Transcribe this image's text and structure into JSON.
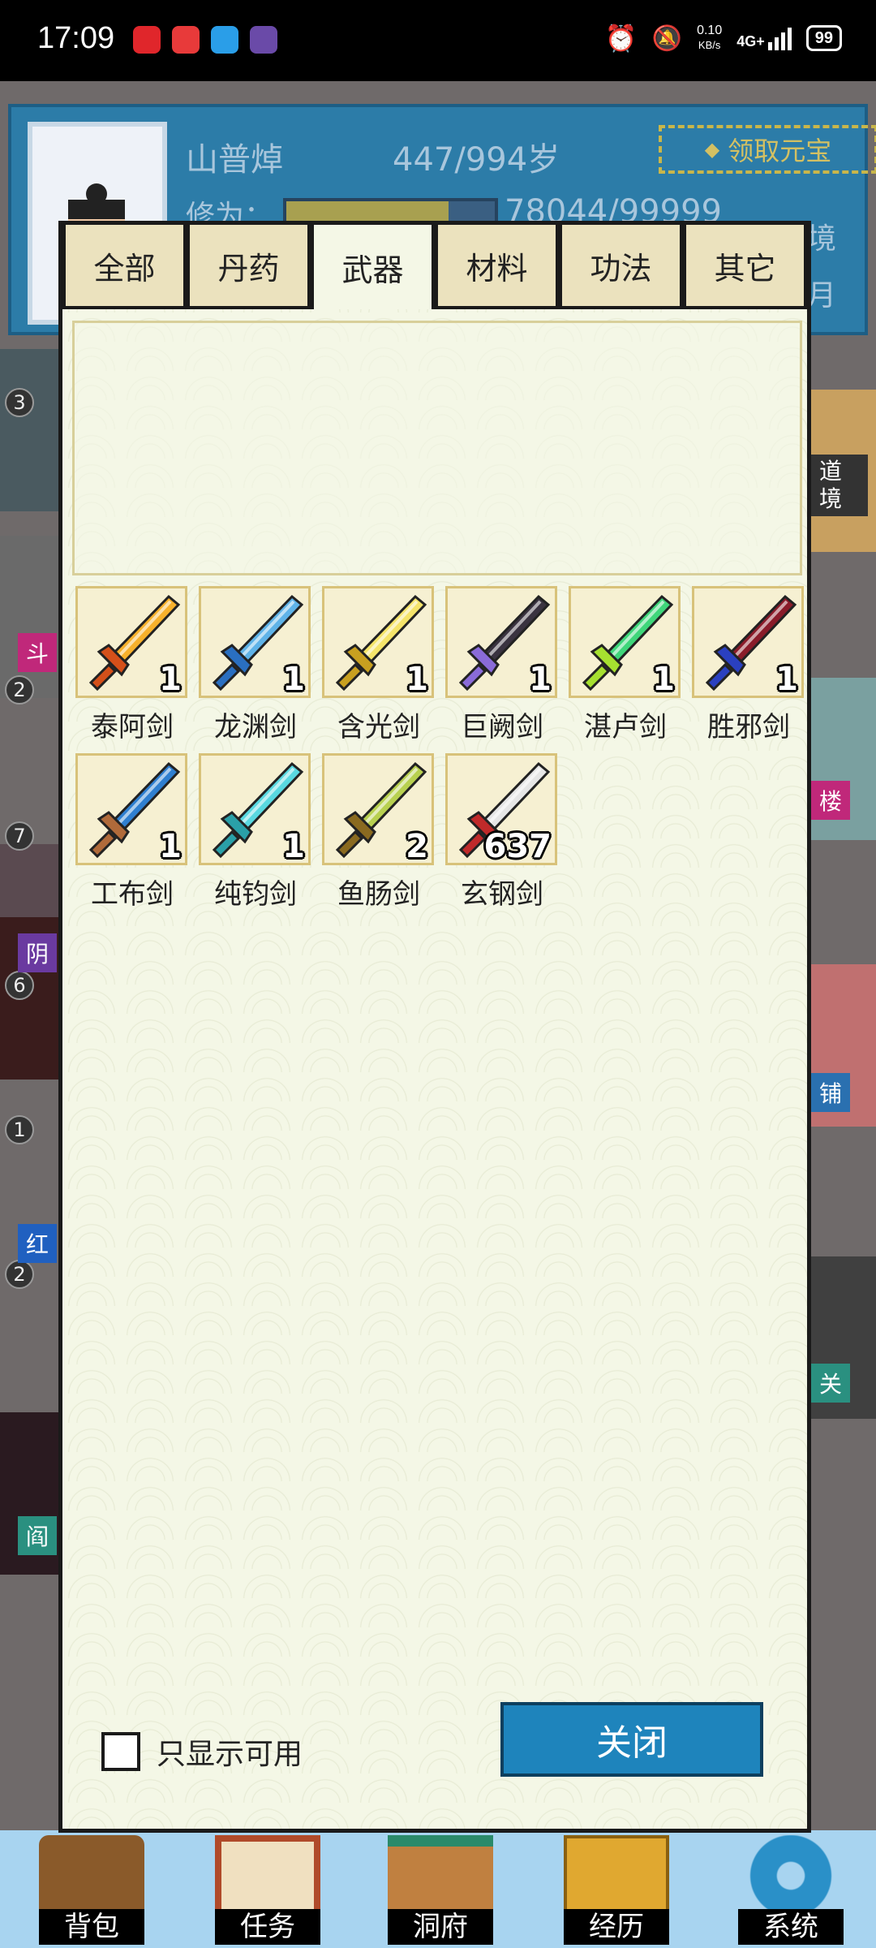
{
  "status_bar": {
    "time": "17:09",
    "speed_value": "0.10",
    "speed_unit": "KB/s",
    "network": "4G+",
    "battery": "99"
  },
  "profile": {
    "name": "山普焯",
    "age": "447/994岁",
    "claim_button": "领取元宝",
    "cultivation_label": "修为：",
    "cultivation_value": "78044/99999",
    "cultivation_progress": 0.78,
    "side_text_1": "境",
    "side_text_2": "月"
  },
  "background_map": {
    "left_tags": [
      "斗",
      "阴",
      "红",
      "阎"
    ],
    "right_tags": [
      "道境",
      "楼",
      "铺",
      "关"
    ],
    "left_numbers": [
      "3",
      "2",
      "7",
      "6",
      "1",
      "2"
    ]
  },
  "tabs": [
    "全部",
    "丹药",
    "武器",
    "材料",
    "功法",
    "其它"
  ],
  "active_tab": "武器",
  "items": [
    {
      "name": "泰阿剑",
      "count": "1",
      "icon": "golden-flame-sword-icon",
      "blade": "#f7b12c",
      "hilt": "#d4501a"
    },
    {
      "name": "龙渊剑",
      "count": "1",
      "icon": "blue-dragon-sword-icon",
      "blade": "#5fb3e8",
      "hilt": "#2a6fc0"
    },
    {
      "name": "含光剑",
      "count": "1",
      "icon": "yellow-light-sword-icon",
      "blade": "#f5e46a",
      "hilt": "#c8a020"
    },
    {
      "name": "巨阙剑",
      "count": "1",
      "icon": "dark-purple-sword-icon",
      "blade": "#3a3340",
      "hilt": "#8a6bd8"
    },
    {
      "name": "湛卢剑",
      "count": "1",
      "icon": "green-jade-sword-icon",
      "blade": "#3fd67a",
      "hilt": "#a6e030"
    },
    {
      "name": "胜邪剑",
      "count": "1",
      "icon": "crimson-evil-sword-icon",
      "blade": "#8a1c2a",
      "hilt": "#2a40c0"
    },
    {
      "name": "工布剑",
      "count": "1",
      "icon": "blue-craft-sword-icon",
      "blade": "#2f7fd0",
      "hilt": "#b06a3a"
    },
    {
      "name": "纯钧剑",
      "count": "1",
      "icon": "cyan-pure-sword-icon",
      "blade": "#59d8e0",
      "hilt": "#2aa0a8"
    },
    {
      "name": "鱼肠剑",
      "count": "2",
      "icon": "fish-gut-dagger-icon",
      "blade": "#b8d050",
      "hilt": "#8a6a20"
    },
    {
      "name": "玄钢剑",
      "count": "637",
      "icon": "steel-sword-icon",
      "blade": "#e6e6e6",
      "hilt": "#c02a2a"
    }
  ],
  "filter_label": "只显示可用",
  "close_button": "关闭",
  "bottom_nav": [
    "背包",
    "任务",
    "洞府",
    "经历",
    "系统"
  ]
}
